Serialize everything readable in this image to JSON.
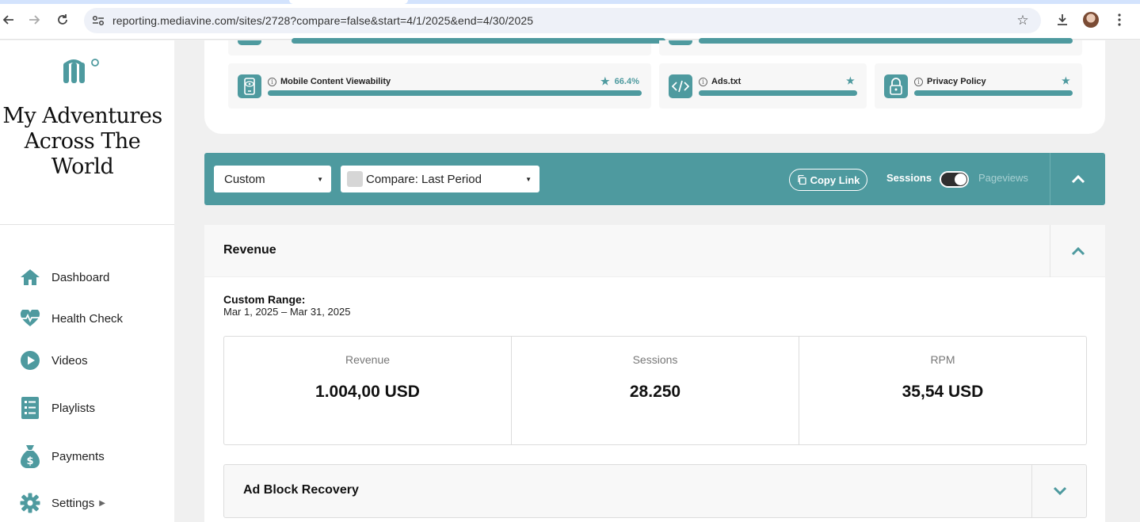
{
  "browser": {
    "url": "reporting.mediavine.com/sites/2728?compare=false&start=4/1/2025&end=4/30/2025"
  },
  "sidebar": {
    "site_title": "My Adventures Across The World",
    "items": [
      {
        "label": "Dashboard",
        "icon": "home-icon"
      },
      {
        "label": "Health Check",
        "icon": "heartbeat-icon"
      },
      {
        "label": "Videos",
        "icon": "play-circle-icon"
      },
      {
        "label": "Playlists",
        "icon": "list-icon"
      },
      {
        "label": "Payments",
        "icon": "money-bag-icon"
      },
      {
        "label": "Settings",
        "icon": "gear-icon"
      }
    ]
  },
  "health_check": {
    "items": [
      {
        "label": "Mobile Content Viewability",
        "value": "66.4%",
        "icon": "mobile-eye-icon"
      },
      {
        "label": "Ads.txt",
        "icon": "code-icon"
      },
      {
        "label": "Privacy Policy",
        "icon": "lock-icon"
      }
    ]
  },
  "filters": {
    "range_select": "Custom",
    "compare_select": "Compare: Last Period",
    "copy_link": "Copy Link",
    "sessions_label": "Sessions",
    "pageviews_label": "Pageviews"
  },
  "revenue": {
    "title": "Revenue",
    "range_label": "Custom Range:",
    "range_value": "Mar 1, 2025 – Mar 31, 2025",
    "stats": [
      {
        "label": "Revenue",
        "value": "1.004,00 USD"
      },
      {
        "label": "Sessions",
        "value": "28.250"
      },
      {
        "label": "RPM",
        "value": "35,54 USD"
      }
    ]
  },
  "ad_block": {
    "title": "Ad Block Recovery"
  },
  "colors": {
    "accent": "#4e9a9f"
  }
}
